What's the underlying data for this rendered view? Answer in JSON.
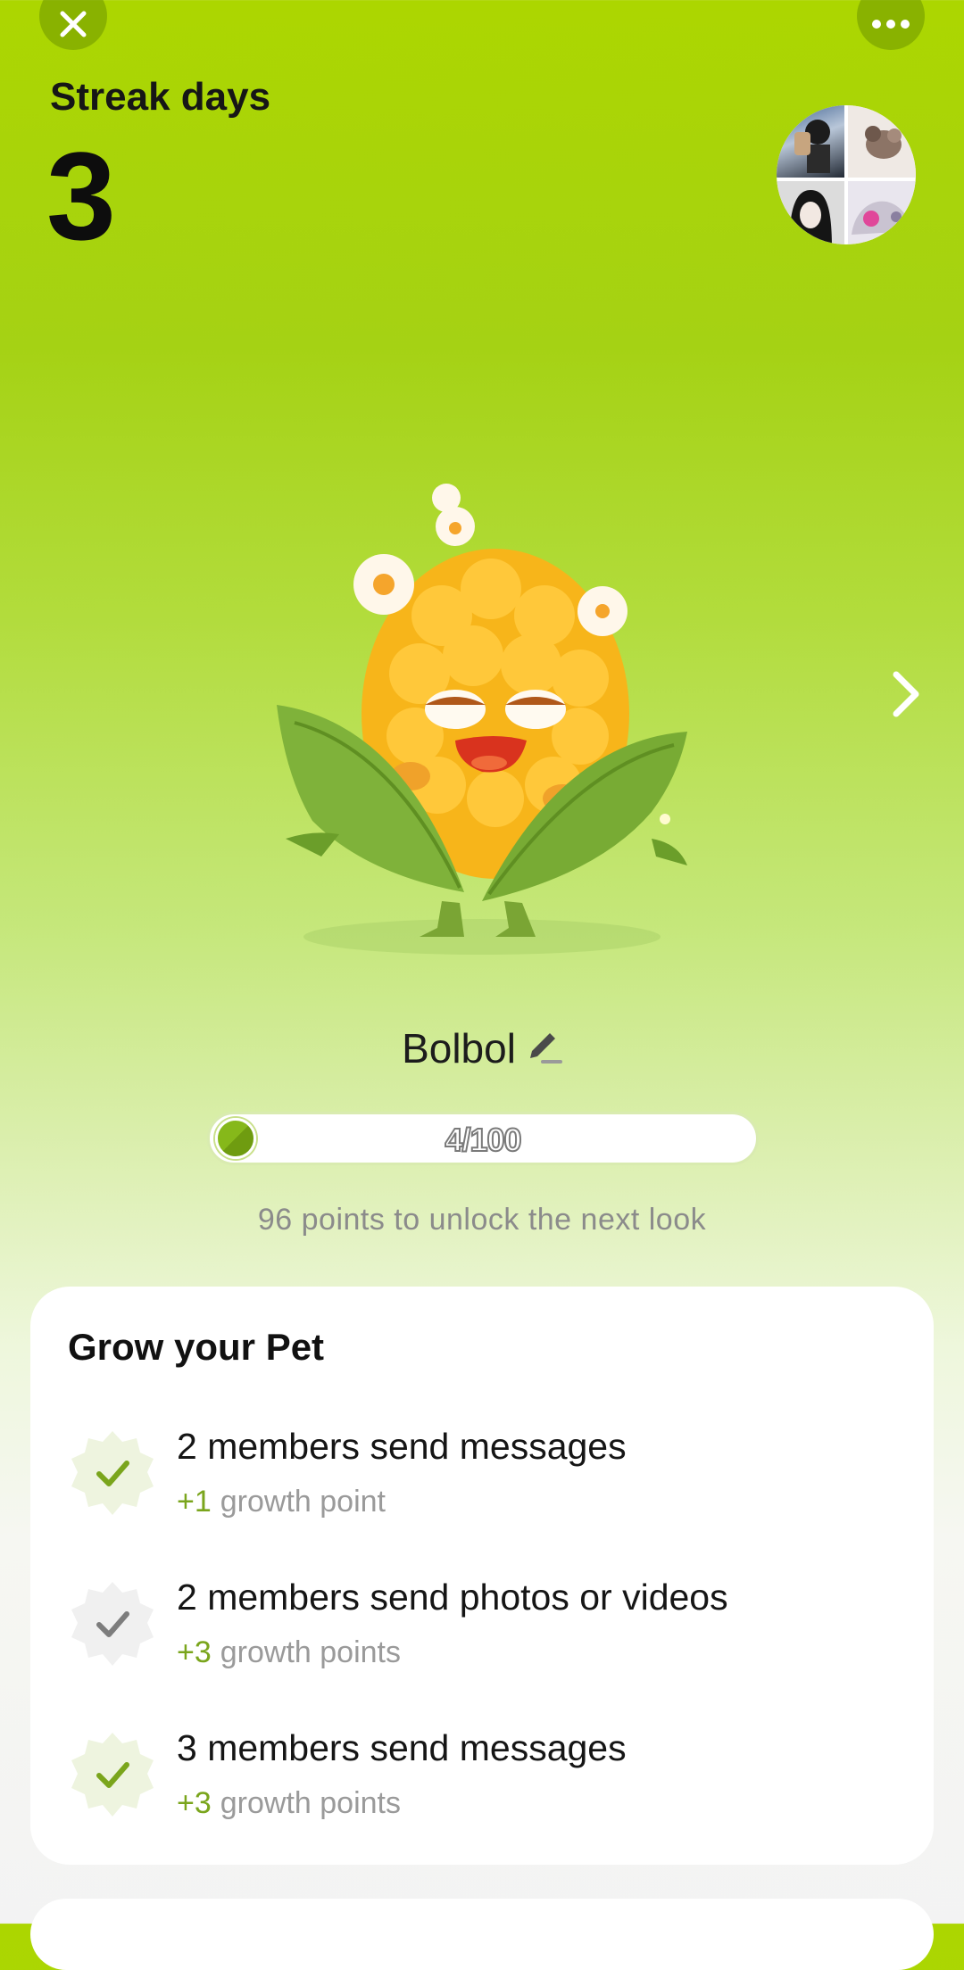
{
  "header": {
    "streak_label": "Streak days",
    "streak_value": "3",
    "close_icon": "close-icon",
    "more_icon": "more-dots-icon",
    "avatars": [
      "member-1",
      "member-2",
      "member-3",
      "member-4"
    ]
  },
  "pet": {
    "name": "Bolbol",
    "edit_icon": "pencil-icon",
    "progress_text": "4/100",
    "progress_fraction": 0.04,
    "unlock_hint": "96 points to unlock the next look",
    "next_icon": "chevron-right-icon"
  },
  "grow": {
    "title": "Grow your Pet",
    "tasks": [
      {
        "title": "2 members send messages",
        "points": "+1",
        "unit": "growth point",
        "done": true
      },
      {
        "title": "2 members send photos or videos",
        "points": "+3",
        "unit": "growth points",
        "done": false
      },
      {
        "title": "3 members send messages",
        "points": "+3",
        "unit": "growth points",
        "done": true
      }
    ]
  },
  "colors": {
    "accent": "#7aa51c",
    "top_background": "#acd600",
    "check_done": "#7aa51c",
    "check_pending": "#7d7d7d"
  }
}
